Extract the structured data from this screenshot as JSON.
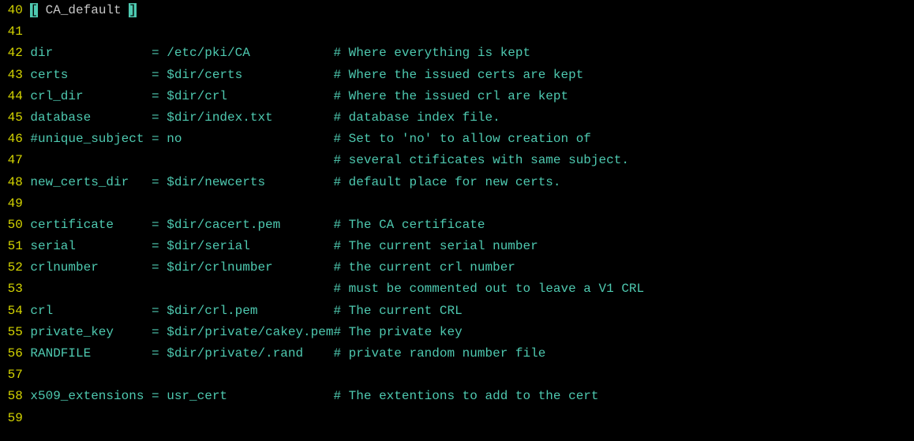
{
  "lines": [
    {
      "no": "40",
      "type": "section",
      "br_open": "[",
      "name": " CA_default ",
      "br_close": "]"
    },
    {
      "no": "41",
      "type": "blank"
    },
    {
      "no": "42",
      "type": "kv",
      "key": "dir             ",
      "eq": "= ",
      "val": "/etc/pki/CA           ",
      "comment": "# Where everything is kept"
    },
    {
      "no": "43",
      "type": "kv",
      "key": "certs           ",
      "eq": "= ",
      "val": "$dir/certs            ",
      "comment": "# Where the issued certs are kept"
    },
    {
      "no": "44",
      "type": "kv",
      "key": "crl_dir         ",
      "eq": "= ",
      "val": "$dir/crl              ",
      "comment": "# Where the issued crl are kept"
    },
    {
      "no": "45",
      "type": "kv",
      "key": "database        ",
      "eq": "= ",
      "val": "$dir/index.txt        ",
      "comment": "# database index file."
    },
    {
      "no": "46",
      "type": "kv",
      "key": "#unique_subject ",
      "eq": "= ",
      "val": "no                    ",
      "comment": "# Set to 'no' to allow creation of"
    },
    {
      "no": "47",
      "type": "contcomment",
      "pad": "                                        ",
      "comment": "# several ctificates with same subject."
    },
    {
      "no": "48",
      "type": "kv",
      "key": "new_certs_dir   ",
      "eq": "= ",
      "val": "$dir/newcerts         ",
      "comment": "# default place for new certs."
    },
    {
      "no": "49",
      "type": "blank"
    },
    {
      "no": "50",
      "type": "kv",
      "key": "certificate     ",
      "eq": "= ",
      "val": "$dir/cacert.pem       ",
      "comment": "# The CA certificate"
    },
    {
      "no": "51",
      "type": "kv",
      "key": "serial          ",
      "eq": "= ",
      "val": "$dir/serial           ",
      "comment": "# The current serial number"
    },
    {
      "no": "52",
      "type": "kv",
      "key": "crlnumber       ",
      "eq": "= ",
      "val": "$dir/crlnumber        ",
      "comment": "# the current crl number"
    },
    {
      "no": "53",
      "type": "contcomment",
      "pad": "                                        ",
      "comment": "# must be commented out to leave a V1 CRL"
    },
    {
      "no": "54",
      "type": "kv",
      "key": "crl             ",
      "eq": "= ",
      "val": "$dir/crl.pem          ",
      "comment": "# The current CRL"
    },
    {
      "no": "55",
      "type": "kv",
      "key": "private_key     ",
      "eq": "= ",
      "val": "$dir/private/cakey.pem",
      "comment": "# The private key"
    },
    {
      "no": "56",
      "type": "kv",
      "key": "RANDFILE        ",
      "eq": "= ",
      "val": "$dir/private/.rand    ",
      "comment": "# private random number file"
    },
    {
      "no": "57",
      "type": "blank"
    },
    {
      "no": "58",
      "type": "kv",
      "key": "x509_extensions ",
      "eq": "= ",
      "val": "usr_cert              ",
      "comment": "# The extentions to add to the cert"
    },
    {
      "no": "59",
      "type": "blank"
    }
  ]
}
